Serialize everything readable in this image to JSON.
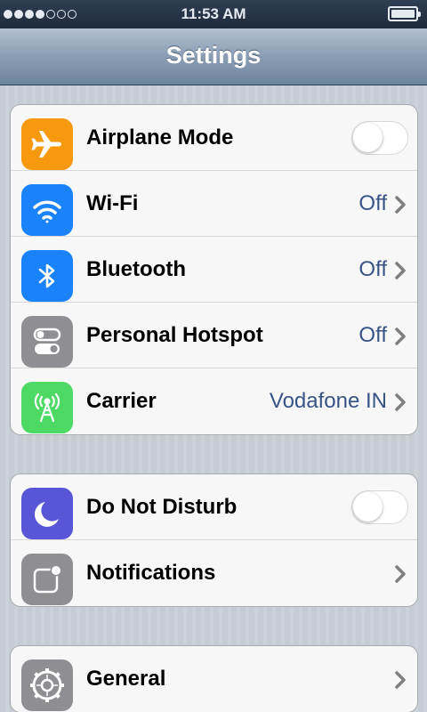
{
  "status_bar": {
    "time": "11:53 AM",
    "signal_strength_dots": 4,
    "signal_total_dots": 7,
    "battery_level": 1.0
  },
  "nav_bar": {
    "title": "Settings"
  },
  "groups": [
    {
      "items": [
        {
          "label": "Airplane Mode",
          "icon": "airplane-icon",
          "icon_color": "#f7990c",
          "control": "toggle",
          "toggle_on": false
        },
        {
          "label": "Wi-Fi",
          "icon": "wifi-icon",
          "icon_color": "#1a82fb",
          "value": "Off",
          "control": "chevron"
        },
        {
          "label": "Bluetooth",
          "icon": "bluetooth-icon",
          "icon_color": "#1a82fb",
          "value": "Off",
          "control": "chevron"
        },
        {
          "label": "Personal Hotspot",
          "icon": "hotspot-icon",
          "icon_color": "#8e8e93",
          "value": "Off",
          "control": "chevron"
        },
        {
          "label": "Carrier",
          "icon": "carrier-antenna-icon",
          "icon_color": "#4cd964",
          "value": "Vodafone IN",
          "control": "chevron"
        }
      ]
    },
    {
      "items": [
        {
          "label": "Do Not Disturb",
          "icon": "moon-icon",
          "icon_color": "#5856d6",
          "control": "toggle",
          "toggle_on": false
        },
        {
          "label": "Notifications",
          "icon": "notifications-icon",
          "icon_color": "#8e8e93",
          "control": "chevron"
        }
      ]
    },
    {
      "items": [
        {
          "label": "General",
          "icon": "gear-icon",
          "icon_color": "#8e8e93",
          "control": "chevron"
        }
      ]
    }
  ],
  "colors": {
    "value_text": "#385487",
    "chevron": "#7f7f7f"
  }
}
